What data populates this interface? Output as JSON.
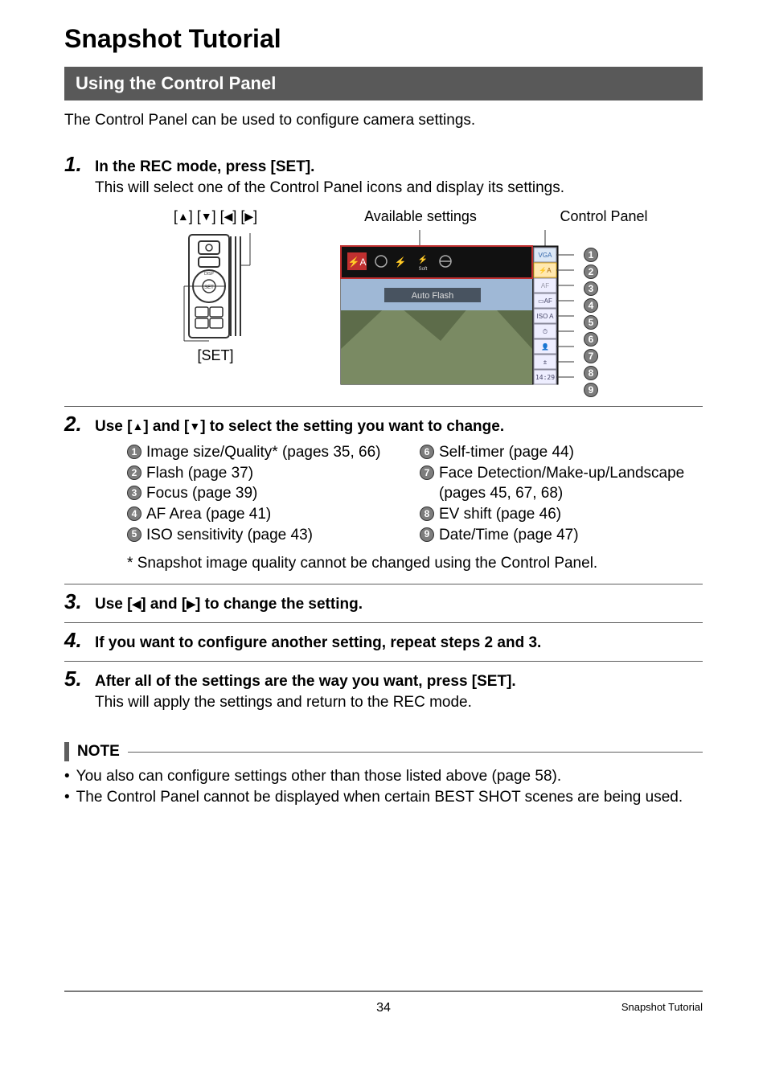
{
  "page": {
    "title": "Snapshot Tutorial",
    "section_header": "Using the Control Panel",
    "intro": "The Control Panel can be used to configure camera settings.",
    "footer_title": "Snapshot Tutorial",
    "page_number": "34"
  },
  "steps": {
    "s1": {
      "num": "1.",
      "heading": "In the REC mode, press [SET].",
      "text": "This will select one of the Control Panel icons and display its settings."
    },
    "s2": {
      "num": "2.",
      "heading_pre": "Use [",
      "heading_mid1": "] and [",
      "heading_post": "] to select the setting you want to change."
    },
    "s3": {
      "num": "3.",
      "heading_pre": "Use [",
      "heading_mid1": "] and [",
      "heading_post": "] to change the setting."
    },
    "s4": {
      "num": "4.",
      "heading": "If you want to configure another setting, repeat steps 2 and 3."
    },
    "s5": {
      "num": "5.",
      "heading": "After all of the settings are the way you want, press [SET].",
      "text": "This will apply the settings and return to the REC mode."
    }
  },
  "diagram": {
    "dir_label_pre": "[",
    "dir_label_sep": "] [",
    "dir_label_post": "]",
    "set_label": "[SET]",
    "available_label": "Available settings",
    "panel_label": "Control Panel",
    "screen": {
      "auto_flash": "Auto Flash",
      "panel_items": [
        "VGA",
        "⚡A",
        "AF",
        "▭AF",
        "ISO A",
        "⏱",
        "👤",
        "±",
        "14:29"
      ]
    },
    "numbers": [
      "1",
      "2",
      "3",
      "4",
      "5",
      "6",
      "7",
      "8",
      "9"
    ]
  },
  "settings_list": {
    "left": [
      {
        "n": "1",
        "t": "Image size/Quality* (pages 35, 66)"
      },
      {
        "n": "2",
        "t": "Flash (page 37)"
      },
      {
        "n": "3",
        "t": "Focus (page 39)"
      },
      {
        "n": "4",
        "t": "AF Area (page 41)"
      },
      {
        "n": "5",
        "t": "ISO sensitivity (page 43)"
      }
    ],
    "right": [
      {
        "n": "6",
        "t": "Self-timer (page 44)"
      },
      {
        "n": "7",
        "t": "Face Detection/Make-up/Landscape (pages 45, 67, 68)"
      },
      {
        "n": "8",
        "t": "EV shift (page 46)"
      },
      {
        "n": "9",
        "t": "Date/Time (page 47)"
      }
    ]
  },
  "footnote": "Snapshot image quality cannot be changed using the Control Panel.",
  "note": {
    "label": "NOTE",
    "items": [
      "You also can configure settings other than those listed above (page 58).",
      "The Control Panel cannot be displayed when certain BEST SHOT scenes are being used."
    ]
  },
  "glyphs": {
    "up": "▲",
    "down": "▼",
    "left": "◀",
    "right": "▶",
    "star": "*",
    "bullet": "•"
  }
}
